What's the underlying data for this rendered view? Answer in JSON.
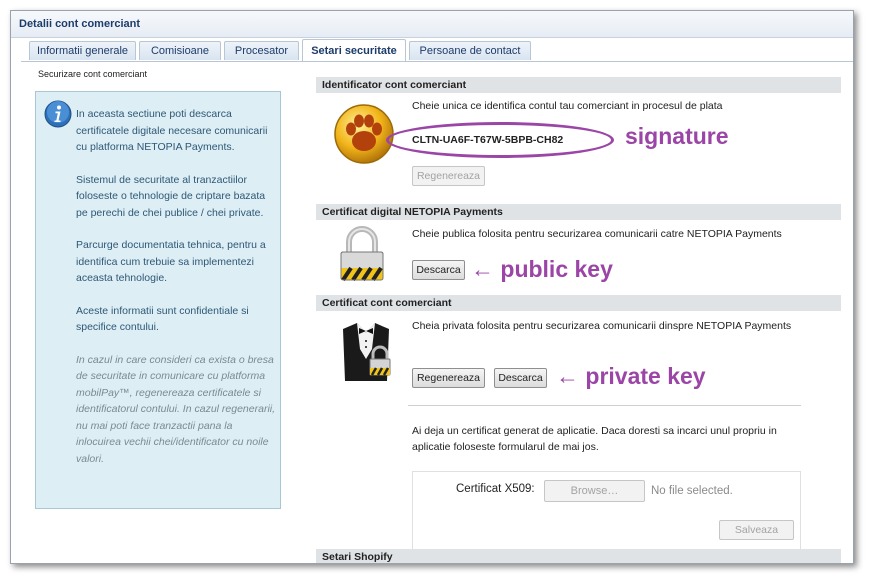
{
  "window": {
    "title": "Detalii cont comerciant"
  },
  "tabs": [
    {
      "label": "Informatii generale",
      "active": false
    },
    {
      "label": "Comisioane",
      "active": false
    },
    {
      "label": "Procesator",
      "active": false
    },
    {
      "label": "Setari securitate",
      "active": true
    },
    {
      "label": "Persoane de contact",
      "active": false
    }
  ],
  "subcaption": "Securizare cont comerciant",
  "info_panel": {
    "paragraphs": [
      "In aceasta sectiune poti descarca certificatele digitale necesare comunicarii cu platforma NETOPIA Payments.",
      "Sistemul de securitate al tranzactiilor foloseste o tehnologie de criptare bazata pe perechi de chei publice / chei private.",
      "Parcurge documentatia tehnica, pentru a identifica cum trebuie sa implementezi aceasta tehnologie.",
      "Aceste informatii sunt confidentiale si specifice contului."
    ],
    "italic_note": "In cazul in care consideri ca exista o bresa de securitate in comunicare cu platforma mobilPay™, regenereaza certificatele si identificatorul contului. In cazul regenerarii, nu mai poti face tranzactii pana la inlocuirea vechii chei/identificator cu noile valori."
  },
  "identifier_section": {
    "header": "Identificator cont comerciant",
    "description": "Cheie unica ce identifica contul tau comerciant in procesul de plata",
    "signature": "CLTN-UA6F-T67W-5BPB-CH82",
    "regenerate_label": "Regenereaza",
    "annotation": "signature"
  },
  "netopia_cert_section": {
    "header": "Certificat digital NETOPIA Payments",
    "description": "Cheie publica folosita pentru securizarea comunicarii catre NETOPIA Payments",
    "download_label": "Descarca",
    "annotation": "← public key"
  },
  "merchant_cert_section": {
    "header": "Certificat cont comerciant",
    "description": "Cheia privata folosita pentru securizarea comunicarii dinspre NETOPIA Payments",
    "regenerate_label": "Regenereaza",
    "download_label": "Descarca",
    "annotation": "← private key",
    "own_cert_note": "Ai deja un certificat generat de aplicatie. Daca doresti sa incarci unul propriu in aplicatie foloseste formularul de mai jos."
  },
  "upload_form": {
    "field_label": "Certificat X509:",
    "browse_label": "Browse…",
    "file_status": "No file selected.",
    "save_label": "Salveaza"
  },
  "next_section": {
    "header": "Setari Shopify"
  },
  "colors": {
    "accent_purple": "#9b45a6",
    "header_gray": "#e0e3e6",
    "info_bg": "#ddeef4"
  }
}
